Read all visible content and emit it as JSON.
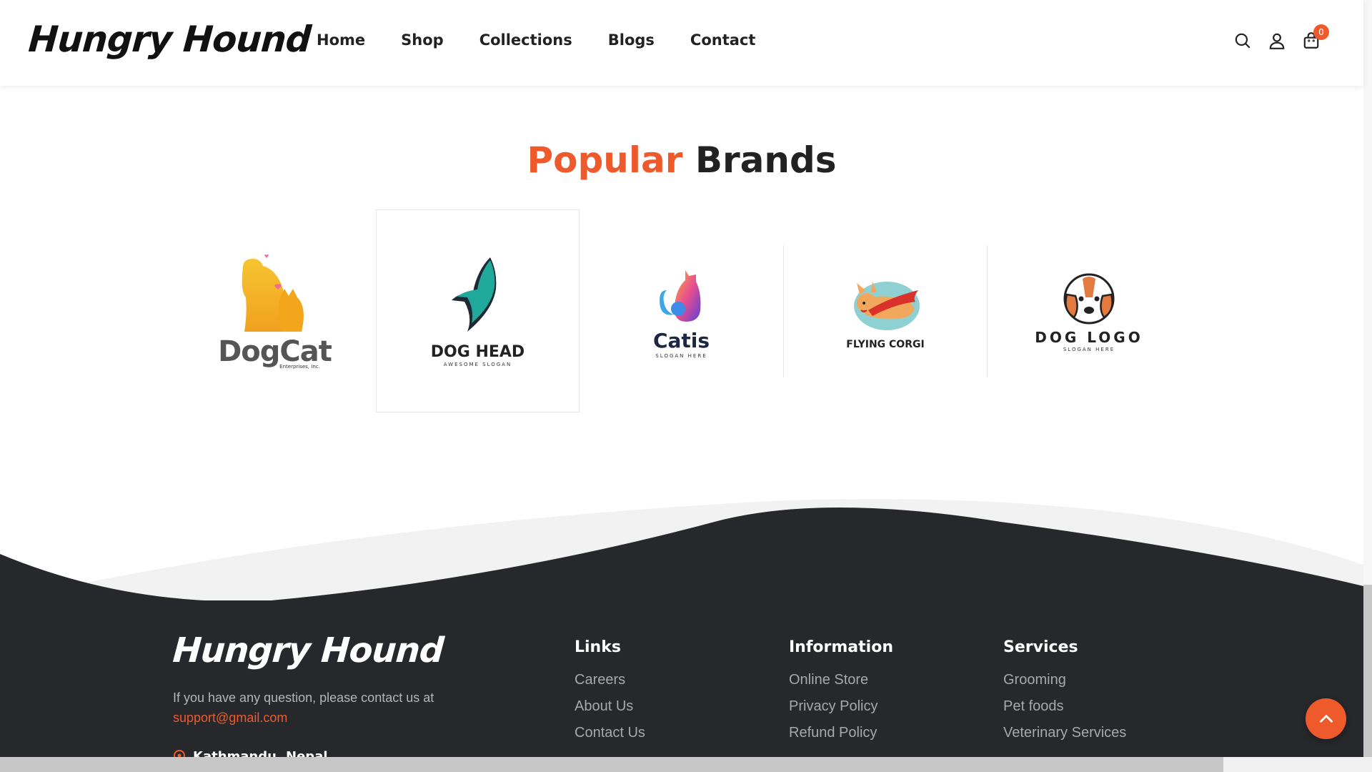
{
  "header": {
    "logo": "Hungry Hound",
    "nav": [
      "Home",
      "Shop",
      "Collections",
      "Blogs",
      "Contact"
    ],
    "icons": [
      "search-icon",
      "user-icon",
      "cart-icon"
    ],
    "cart_count": "0"
  },
  "brands_section": {
    "title_accent": "Popular",
    "title_rest": "Brands",
    "brands": [
      {
        "name": "DogCat",
        "slogan": "Enterprises, Inc."
      },
      {
        "name": "DOG HEAD",
        "slogan": "AWESOME SLOGAN"
      },
      {
        "name": "Catis",
        "slogan": "SLOGAN HERE"
      },
      {
        "name": "FLYING CORGI",
        "slogan": ""
      },
      {
        "name": "DOG LOGO",
        "slogan": "SLOGAN HERE"
      }
    ]
  },
  "footer": {
    "logo": "Hungry Hound",
    "contact_text": "If you have any question, please contact us at",
    "email": "support@gmail.com",
    "address": "Kathmandu, Nepal",
    "columns": [
      {
        "title": "Links",
        "items": [
          "Careers",
          "About Us",
          "Contact Us"
        ]
      },
      {
        "title": "Information",
        "items": [
          "Online Store",
          "Privacy Policy",
          "Refund Policy"
        ]
      },
      {
        "title": "Services",
        "items": [
          "Grooming",
          "Pet foods",
          "Veterinary Services"
        ]
      }
    ]
  },
  "colors": {
    "accent": "#ee5a2b",
    "footer_bg": "#27282c",
    "text": "#222222"
  }
}
